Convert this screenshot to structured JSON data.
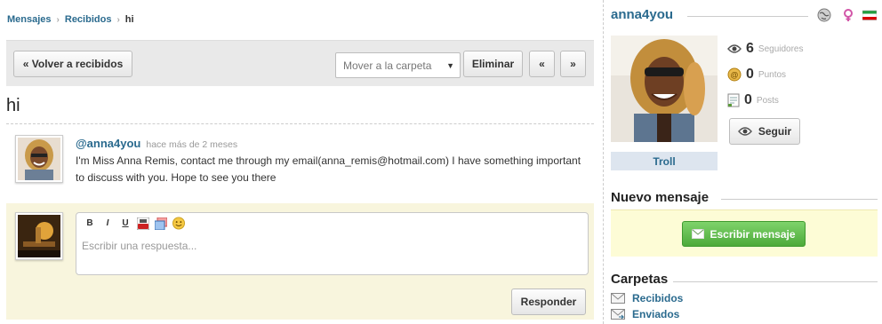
{
  "breadcrumb": {
    "mensajes": "Mensajes",
    "recibidos": "Recibidos",
    "current": "hi"
  },
  "toolbar": {
    "back_label": "« Volver a recibidos",
    "move_select": "Mover a la carpeta",
    "delete_label": "Eliminar",
    "prev_label": "«",
    "next_label": "»"
  },
  "message": {
    "title": "hi",
    "user": "@anna4you",
    "time": "hace más de 2 meses",
    "body": "I'm Miss Anna Remis, contact me through my email(anna_remis@hotmail.com) I have something important to discuss with you. Hope to see you there"
  },
  "reply": {
    "toolbar": [
      "B",
      "I",
      "U"
    ],
    "placeholder": "Escribir una respuesta...",
    "submit_label": "Responder"
  },
  "profile": {
    "name": "anna4you",
    "followers": {
      "count": "6",
      "label": "Seguidores"
    },
    "points": {
      "count": "0",
      "label": "Puntos"
    },
    "posts": {
      "count": "0",
      "label": "Posts"
    },
    "follow_label": "Seguir",
    "rank": "Troll"
  },
  "new_message": {
    "title": "Nuevo mensaje",
    "button_label": "Escribir mensaje"
  },
  "folders": {
    "title": "Carpetas",
    "items": [
      "Recibidos",
      "Enviados"
    ]
  },
  "colors": {
    "link": "#2a6a8e",
    "reply_bg": "#f8f5dd",
    "green": "#4daa3a"
  }
}
